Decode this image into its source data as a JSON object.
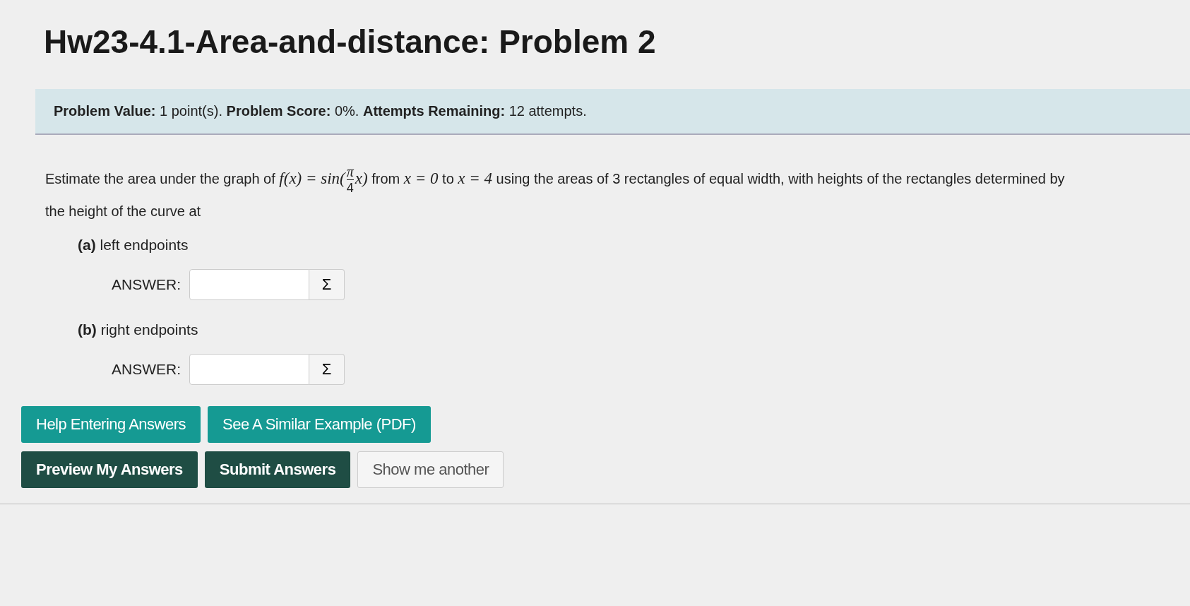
{
  "title": "Hw23-4.1-Area-and-distance: Problem 2",
  "info_bar": "**Problem Value:** 1 point(s). **Problem Score:** 0%. **Attempts Remaining:** 12 attempts.",
  "prompt": [
    {
      "kind": "text",
      "text": "Estimate the area under the graph of "
    },
    {
      "kind": "math",
      "text": "f(x) = sin("
    },
    {
      "kind": "fraction",
      "num": "π",
      "den": "4"
    },
    {
      "kind": "math",
      "text": "x)"
    },
    {
      "kind": "text",
      "text": " from "
    },
    {
      "kind": "math",
      "text": "x = 0"
    },
    {
      "kind": "text",
      "text": " to "
    },
    {
      "kind": "math",
      "text": "x = 4"
    },
    {
      "kind": "text",
      "text": " using the areas of 3 rectangles of equal width, with heights of the rectangles determined by the height of the curve at"
    }
  ],
  "parts": [
    {
      "label": "(a)",
      "text": "left endpoints",
      "answer_label": "ANSWER:",
      "equation_button": "Σ"
    },
    {
      "label": "(b)",
      "text": "right endpoints",
      "answer_label": "ANSWER:",
      "equation_button": "Σ"
    }
  ],
  "button_rows": [
    [
      {
        "label": "Help Entering Answers",
        "kind": "help"
      },
      {
        "label": "See A Similar Example (PDF)",
        "kind": "help"
      }
    ],
    [
      {
        "label": "Preview My Answers",
        "kind": "primary"
      },
      {
        "label": "Submit Answers",
        "kind": "primary"
      },
      {
        "label": "Show me another",
        "kind": "plain"
      }
    ]
  ]
}
